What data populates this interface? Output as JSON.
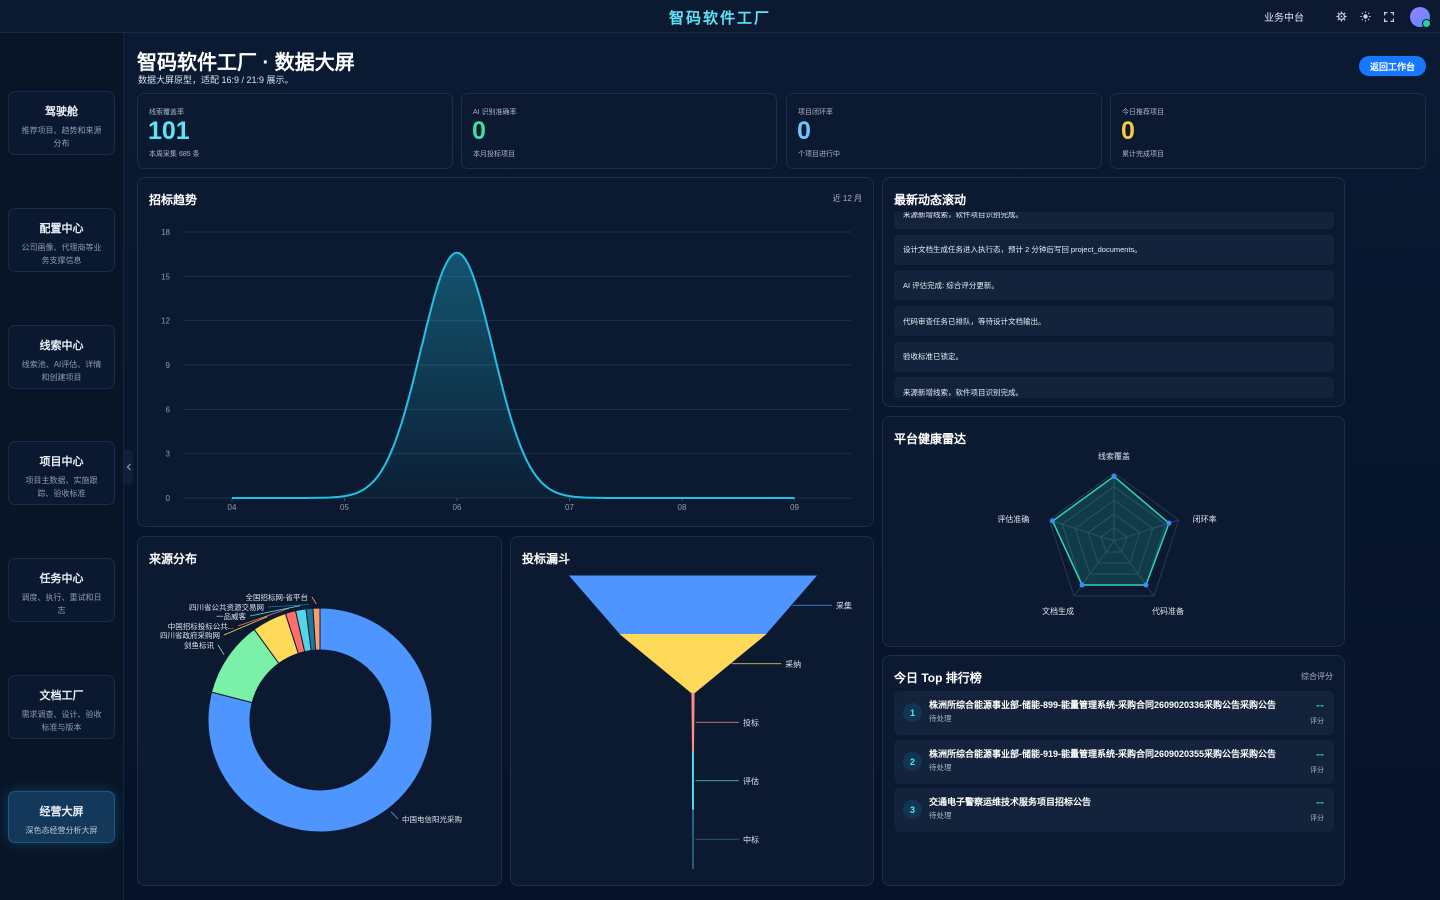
{
  "topbar": {
    "title": "智码软件工厂",
    "biz_link": "业务中台",
    "icons": [
      "gear-icon",
      "sun-icon",
      "fullscreen-icon"
    ]
  },
  "sidebar": {
    "items": [
      {
        "title": "驾驶舱",
        "desc": "推荐项目、趋势和来源分布"
      },
      {
        "title": "配置中心",
        "desc": "公司画像、代理商等业务支撑信息"
      },
      {
        "title": "线索中心",
        "desc": "线索池、AI评估、详情和创建项目"
      },
      {
        "title": "项目中心",
        "desc": "项目主数据、实施跟踪、验收标准"
      },
      {
        "title": "任务中心",
        "desc": "调度、执行、重试和日志"
      },
      {
        "title": "文档工厂",
        "desc": "需求调查、设计、验收标准与版本"
      },
      {
        "title": "经营大屏",
        "desc": "深色态经营分析大屏",
        "active": true
      }
    ]
  },
  "header": {
    "title": "智码软件工厂 · 数据大屏",
    "subtitle": "数据大屏原型，适配 16:9 / 21:9 展示。",
    "back_button": "返回工作台"
  },
  "kpis": [
    {
      "label": "线索覆盖率",
      "value": "101",
      "sub": "本周采集 685 条",
      "color": "#5ee4f7"
    },
    {
      "label": "AI 识别准确率",
      "value": "0",
      "sub": "本月投标项目",
      "color": "#3de0a0"
    },
    {
      "label": "项目闭环率",
      "value": "0",
      "sub": "个项目进行中",
      "color": "#6fc3ff"
    },
    {
      "label": "今日推荐项目",
      "value": "0",
      "sub": "累计完成项目",
      "color": "#f7c948"
    }
  ],
  "trend": {
    "title": "招标趋势",
    "range": "近 12 月"
  },
  "feed": {
    "title": "最新动态滚动",
    "items": [
      "来源新增线索，软件项目识别完成。",
      "设计文档生成任务进入执行态，预计 2 分钟后写回 project_documents。",
      "AI 评估完成: 综合评分更新。",
      "代码审查任务已排队，等待设计文档输出。",
      "验收标准已锁定。",
      "来源新增线索，软件项目识别完成。"
    ]
  },
  "radar": {
    "title": "平台健康雷达"
  },
  "source": {
    "title": "来源分布"
  },
  "funnel": {
    "title": "投标漏斗"
  },
  "ranking": {
    "title": "今日 Top 排行榜",
    "extra": "综合评分",
    "items": [
      {
        "num": "1",
        "title": "株洲所综合能源事业部-储能-899-能量管理系统-采购合同2609020336采购公告采购公告",
        "status": "待处理",
        "score": "--",
        "score_label": "评分"
      },
      {
        "num": "2",
        "title": "株洲所综合能源事业部-储能-919-能量管理系统-采购合同2609020355采购公告采购公告",
        "status": "待处理",
        "score": "--",
        "score_label": "评分"
      },
      {
        "num": "3",
        "title": "交通电子警察运维技术服务项目招标公告",
        "status": "待处理",
        "score": "--",
        "score_label": "评分"
      }
    ]
  },
  "chart_data": [
    {
      "type": "area",
      "title": "招标趋势",
      "x": [
        "04",
        "05",
        "06",
        "07",
        "08",
        "09"
      ],
      "series": [
        {
          "values": [
            0,
            0,
            16.6,
            0,
            0,
            0
          ]
        }
      ],
      "yticks": [
        0,
        3,
        6,
        9,
        12,
        15,
        18
      ],
      "ylim": [
        0,
        18
      ],
      "grid": true,
      "color": "#22c2e6"
    },
    {
      "type": "radar",
      "title": "平台健康雷达",
      "axes": [
        "线索覆盖",
        "闭环率",
        "代码准备",
        "文档生成",
        "评估准确"
      ],
      "values": [
        0.95,
        0.85,
        0.8,
        0.8,
        0.95
      ],
      "color": "#2ed3b7"
    },
    {
      "type": "pie",
      "title": "来源分布",
      "donut": true,
      "slices": [
        {
          "label": "中国电信阳光采购",
          "value": 79,
          "color": "#4f95ff"
        },
        {
          "label": "剑鱼标讯",
          "value": 11,
          "color": "#7af0a8"
        },
        {
          "label": "四川省政府采购网",
          "value": 5,
          "color": "#ffd95a"
        },
        {
          "label": "中国招标投标公共...",
          "value": 1.5,
          "color": "#ff6d6d"
        },
        {
          "label": "一品威客",
          "value": 1.5,
          "color": "#55d4e8"
        },
        {
          "label": "四川省公共资源交易网",
          "value": 1,
          "color": "#1a7aa0"
        },
        {
          "label": "全国招标网-省平台",
          "value": 1,
          "color": "#ff9c6b"
        }
      ]
    },
    {
      "type": "funnel",
      "title": "投标漏斗",
      "stages": [
        {
          "label": "采集",
          "value": 685,
          "color": "#4f95ff"
        },
        {
          "label": "采纳",
          "value": 402,
          "color": "#ffd95a"
        },
        {
          "label": "投标",
          "value": 6,
          "color": "#ff8a8a"
        },
        {
          "label": "评估",
          "value": 2,
          "color": "#55d4e8"
        },
        {
          "label": "中标",
          "value": 1,
          "color": "#2a6a8a"
        }
      ]
    }
  ]
}
